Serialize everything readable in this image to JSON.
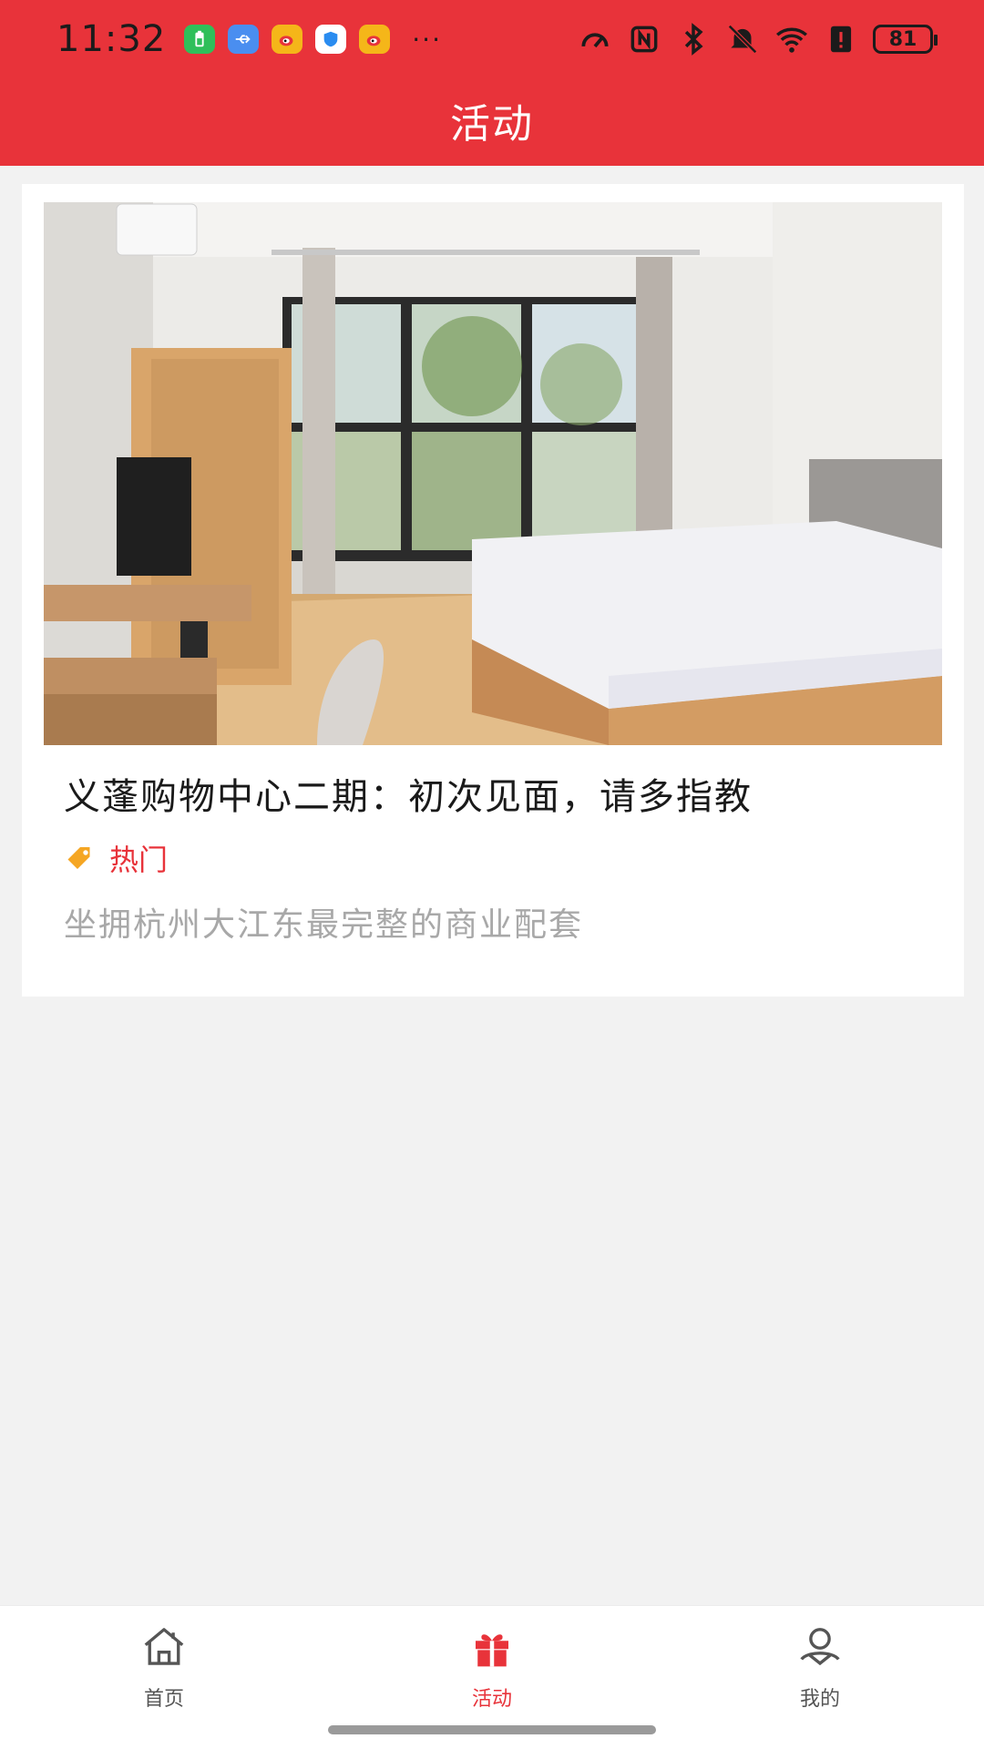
{
  "status_bar": {
    "time": "11:32",
    "apps": [
      {
        "icon": "battery-saver-app-icon",
        "color": "#2fbf5a"
      },
      {
        "icon": "usb-app-icon",
        "color": "#4a8ef0"
      },
      {
        "icon": "weibo-app-icon",
        "color": "#f5b619"
      },
      {
        "icon": "shield-app-icon",
        "color": "#2a8cf0"
      },
      {
        "icon": "weibo-app-icon",
        "color": "#f5b619"
      }
    ],
    "more": "···",
    "battery_level": "81"
  },
  "header": {
    "title": "活动",
    "background": "#e8333a"
  },
  "activity_card": {
    "title": "义蓬购物中心二期：初次见面，请多指教",
    "tag": "热门",
    "tag_icon": "tag-icon",
    "description": "坐拥杭州大江东最完整的商业配套"
  },
  "bottom_nav": {
    "items": [
      {
        "label": "首页",
        "icon": "home-icon",
        "active": false
      },
      {
        "label": "活动",
        "icon": "gift-icon",
        "active": true
      },
      {
        "label": "我的",
        "icon": "user-icon",
        "active": false
      }
    ],
    "active_color": "#e8333a"
  }
}
